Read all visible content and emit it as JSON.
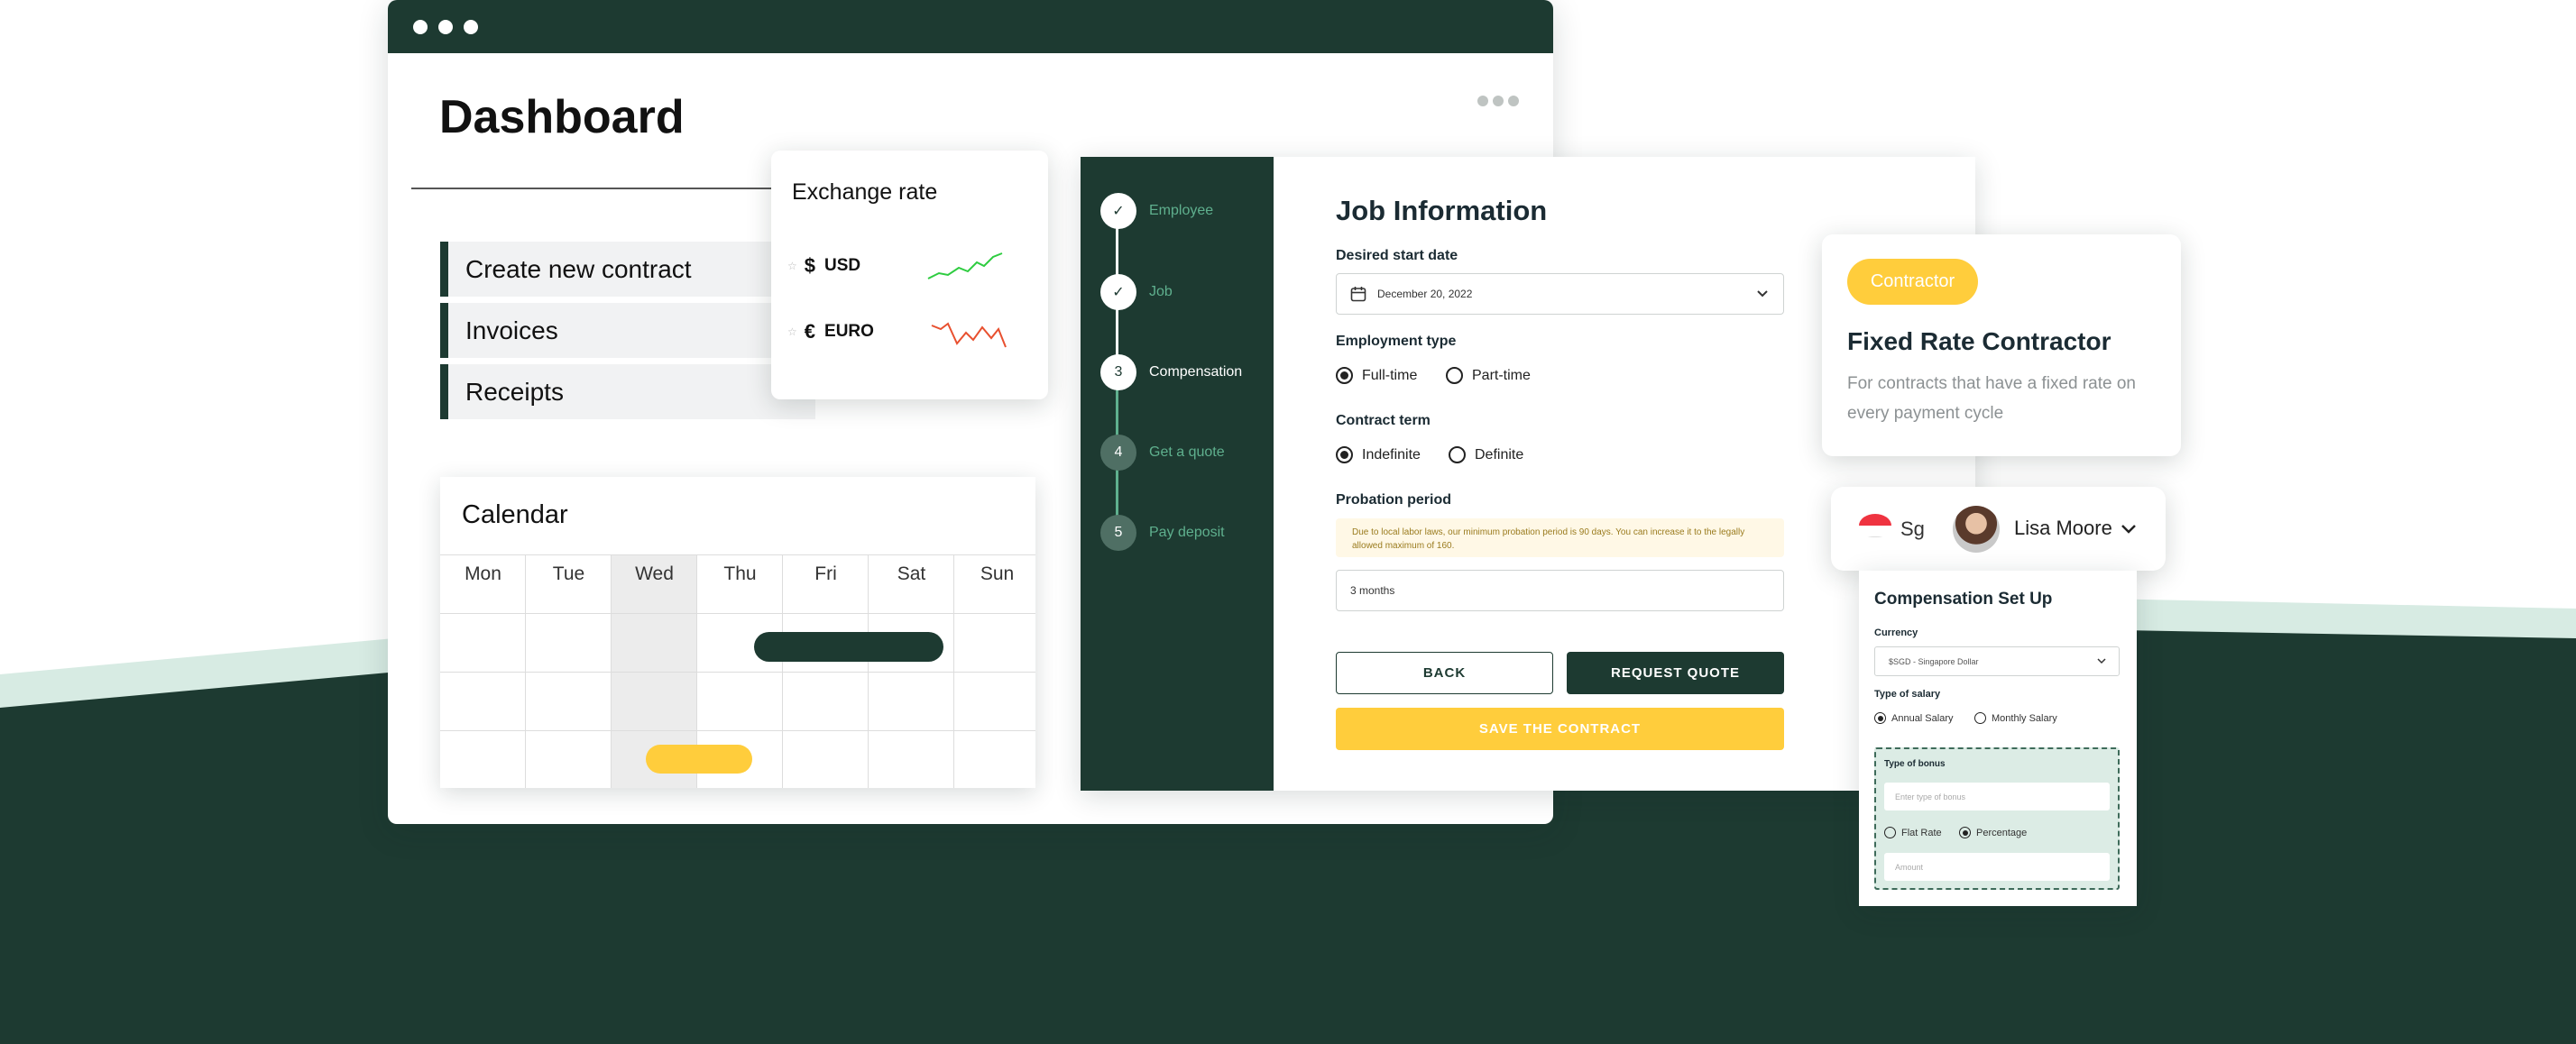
{
  "dashboard": {
    "title": "Dashboard",
    "menu": [
      "Create new contract",
      "Invoices",
      "Receipts"
    ]
  },
  "calendar": {
    "title": "Calendar",
    "days": [
      "Mon",
      "Tue",
      "Wed",
      "Thu",
      "Fri",
      "Sat",
      "Sun"
    ]
  },
  "exchange": {
    "title": "Exchange rate",
    "rows": [
      {
        "symbol": "$",
        "code": "USD",
        "trend_color": "#2ecc40"
      },
      {
        "symbol": "€",
        "code": "EURO",
        "trend_color": "#e8502f"
      }
    ]
  },
  "steps": [
    {
      "num": "✓",
      "label": "Employee",
      "state": "done"
    },
    {
      "num": "✓",
      "label": "Job",
      "state": "done"
    },
    {
      "num": "3",
      "label": "Compensation",
      "state": "current"
    },
    {
      "num": "4",
      "label": "Get a quote",
      "state": "todo"
    },
    {
      "num": "5",
      "label": "Pay deposit",
      "state": "todo"
    }
  ],
  "job": {
    "title": "Job Information",
    "start_label": "Desired start date",
    "start_value": "December 20, 2022",
    "emp_label": "Employment type",
    "emp_options": [
      "Full-time",
      "Part-time"
    ],
    "term_label": "Contract term",
    "term_options": [
      "Indefinite",
      "Definite"
    ],
    "prob_label": "Probation period",
    "prob_note": "Due to local labor laws, our minimum probation period is 90 days. You can increase it to the legally allowed maximum of 160.",
    "prob_value": "3 months",
    "back": "BACK",
    "quote": "REQUEST QUOTE",
    "save": "SAVE THE CONTRACT"
  },
  "contractor": {
    "badge": "Contractor",
    "title": "Fixed Rate Contractor",
    "desc": "For contracts that have a fixed rate on every payment cycle"
  },
  "user": {
    "country": "Sg",
    "name": "Lisa Moore"
  },
  "comp": {
    "title": "Compensation Set Up",
    "currency_label": "Currency",
    "currency_value": "$SGD - Singapore Dollar",
    "salary_label": "Type of salary",
    "salary_options": [
      "Annual Salary",
      "Monthly Salary"
    ],
    "bonus_label": "Type of bonus",
    "bonus_placeholder": "Enter type of bonus",
    "bonus_options": [
      "Flat Rate",
      "Percentage"
    ],
    "amount_placeholder": "Amount"
  },
  "colors": {
    "brand_dark": "#1d3a31",
    "accent_yellow": "#ffcd3c",
    "mint": "#d7ebe3"
  }
}
